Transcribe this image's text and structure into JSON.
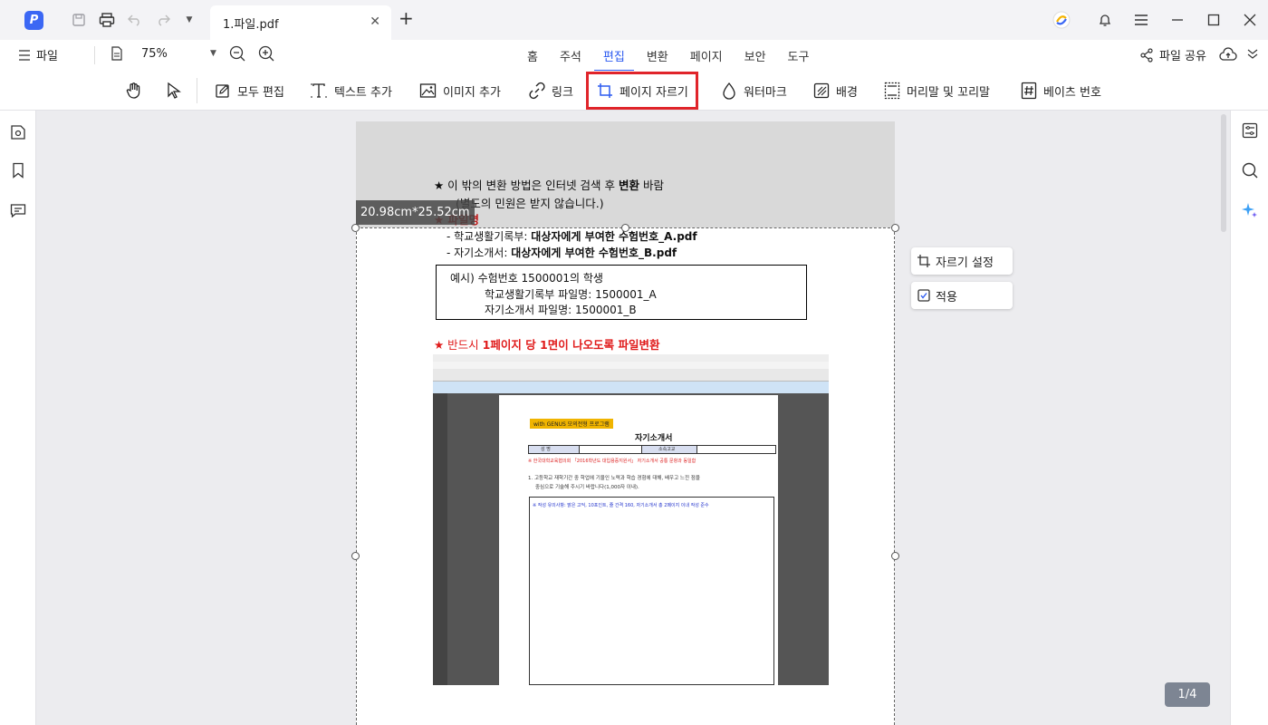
{
  "titlebar": {
    "tab_title": "1.파일.pdf",
    "new_tab": "+",
    "close_tab": "✕"
  },
  "menubar": {
    "file_label": "파일",
    "zoom_value": "75%",
    "tabs": [
      "홈",
      "주석",
      "편집",
      "변환",
      "페이지",
      "보안",
      "도구"
    ],
    "active_tab": "편집",
    "share_label": "파일 공유"
  },
  "toolbar": {
    "items": [
      {
        "label": "모두 편집",
        "icon": "edit-all-icon"
      },
      {
        "label": "텍스트 추가",
        "icon": "text-add-icon"
      },
      {
        "label": "이미지 추가",
        "icon": "image-add-icon"
      },
      {
        "label": "링크",
        "icon": "link-icon"
      },
      {
        "label": "페이지 자르기",
        "icon": "crop-icon"
      },
      {
        "label": "워터마크",
        "icon": "watermark-icon"
      },
      {
        "label": "배경",
        "icon": "background-icon"
      },
      {
        "label": "머리말 및 꼬리말",
        "icon": "header-footer-icon"
      },
      {
        "label": "베이츠 번호",
        "icon": "bates-number-icon"
      }
    ],
    "highlight_color": "#e0242a"
  },
  "crop": {
    "size_label": "20.98cm*25.52cm",
    "settings_label": "자르기 설정",
    "apply_label": "적용"
  },
  "document": {
    "line1_a": "★ 이 밖의 변환 방법은 인터넷 검색 후 ",
    "line1_b": "변환",
    "line1_c": " 바람",
    "line2": "(별도의 민원은 받지 않습니다.)",
    "line3_red": "★ 파일명",
    "line4_a": "-  학교생활기록부: ",
    "line4_b": "대상자에게 부여한 수험번호_A.pdf",
    "line5_a": "-  자기소개서: ",
    "line5_b": "대상자에게 부여한 수험번호_B.pdf",
    "example_1": "예시) 수험번호 1500001의 학생",
    "example_2": "학교생활기록부 파일명: 1500001_A",
    "example_3": "자기소개서 파일명: 1500001_B",
    "line6_a": "★ 반드시 ",
    "line6_b": "1페이지 당 1면이 나오도록 파일변환",
    "embedded": {
      "badge": "with GENUS 모의전형 프로그램",
      "heading": "자기소개서",
      "col1": "성      명",
      "col2": "소속고교",
      "note": "※ 한국대학교육협의회 「2016학년도 대입용증지원서」 자기소개서 공통 문항과 동일함",
      "q1": "1.  고등학교 재학기간 중 학업에 기울인 노력과 학습 경험에 대해, 배우고 느낀 점을",
      "q1b": "중심으로 기술해 주시기 바랍니다(1,000자 이내).",
      "box_note": "※ 작성 유의사항: 맑은 고딕, 10포인트, 줄 간격 160, 자기소개서 총 2페이지 이내 작성 준수"
    }
  },
  "page_counter": "1/4"
}
